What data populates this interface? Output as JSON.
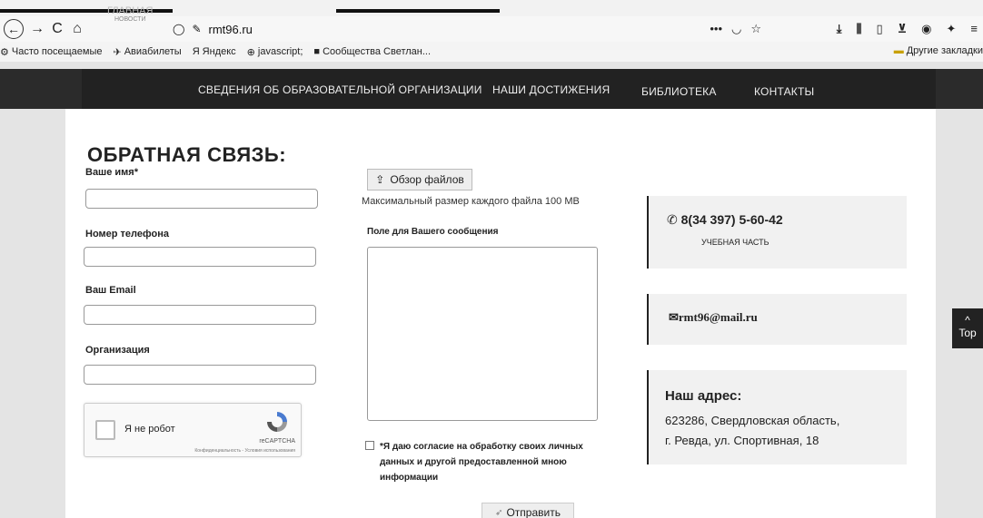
{
  "browser": {
    "url": "rmt96.ru",
    "url_extra": "•••",
    "bookmarks": [
      {
        "icon": "⚙",
        "label": "Часто посещаемые"
      },
      {
        "icon": "✈",
        "label": "Авиабилеты"
      },
      {
        "icon": "Я",
        "label": "Яндекс"
      },
      {
        "icon": "⊕",
        "label": "javascript;"
      },
      {
        "icon": "■",
        "label": "Сообщества Светлан..."
      }
    ],
    "other_bookmarks": "Другие закладки"
  },
  "nav": {
    "home": "ГЛАВНАЯ",
    "home_sub": "НОВОСТИ",
    "items": [
      "СВЕДЕНИЯ ОБ ОБРАЗОВАТЕЛЬНОЙ ОРГАНИЗАЦИИ",
      "НАШИ ДОСТИЖЕНИЯ",
      "БИБЛИОТЕКА",
      "КОНТАКТЫ"
    ]
  },
  "form": {
    "title": "ОБРАТНАЯ СВЯЗЬ:",
    "name_label": "Ваше имя*",
    "phone_label": "Номер телефона",
    "email_label": "Ваш Email",
    "org_label": "Организация",
    "file_button": "Обзор файлов",
    "file_note": "Максимальный размер каждого файла 100 MB",
    "message_label": "Поле для Вашего сообщения",
    "consent": "*Я даю согласие на обработку своих личных данных и другой предоставленной мною информации",
    "submit": "Отправить"
  },
  "captcha": {
    "label": "Я не робот",
    "brand": "reCAPTCHA",
    "terms": "Конфиденциальность - Условия использования"
  },
  "contacts": {
    "phone": "8(34 397) 5-60-42",
    "phone_sub": "УЧЕБНАЯ ЧАСТЬ",
    "email": "rmt96@mail.ru",
    "address_title": "Наш адрес:",
    "address_line1": "623286, Свердловская область,",
    "address_line2": "г. Ревда, ул. Спортивная, 18"
  },
  "scroll_top": "Top"
}
